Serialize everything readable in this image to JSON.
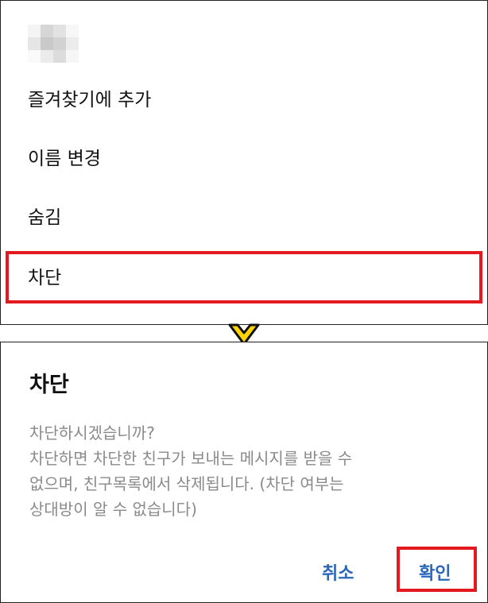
{
  "menu": {
    "items": [
      {
        "label": "즐겨찾기에 추가"
      },
      {
        "label": "이름 변경"
      },
      {
        "label": "숨김"
      },
      {
        "label": "차단"
      }
    ]
  },
  "dialog": {
    "title": "차단",
    "message_lines": [
      "차단하시겠습니까?",
      "차단하면 차단한 친구가 보내는 메시지를 받을 수",
      "없으며, 친구목록에서 삭제됩니다. (차단 여부는",
      "상대방이 알 수 없습니다)"
    ],
    "cancel_label": "취소",
    "confirm_label": "확인"
  },
  "colors": {
    "highlight": "#e3191f",
    "button_text": "#2a67b8",
    "message_text": "#8a8a8a",
    "arrow_fill": "#ffd400"
  },
  "icons": {
    "transition": "chevron-down-icon"
  }
}
